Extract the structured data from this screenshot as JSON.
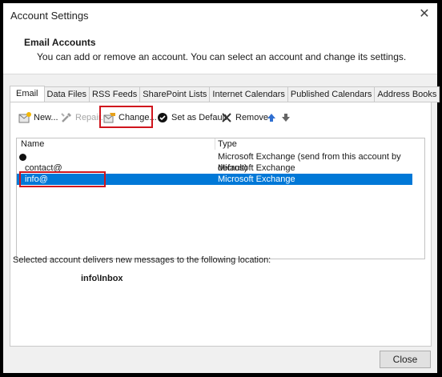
{
  "window": {
    "title": "Account Settings"
  },
  "header": {
    "title": "Email Accounts",
    "description": "You can add or remove an account. You can select an account and change its settings."
  },
  "tabs": [
    {
      "label": "Email",
      "active": true
    },
    {
      "label": "Data Files"
    },
    {
      "label": "RSS Feeds"
    },
    {
      "label": "SharePoint Lists"
    },
    {
      "label": "Internet Calendars"
    },
    {
      "label": "Published Calendars"
    },
    {
      "label": "Address Books"
    }
  ],
  "toolbar": {
    "new": "New...",
    "repair": "Repair...",
    "change": "Change...",
    "set_default": "Set as Default",
    "remove": "Remove"
  },
  "list": {
    "columns": [
      "Name",
      "Type"
    ],
    "rows": [
      {
        "name": "",
        "type": "Microsoft Exchange (send from this account by default)",
        "default": true
      },
      {
        "name": "contact@",
        "type": "Microsoft Exchange"
      },
      {
        "name": "info@",
        "type": "Microsoft Exchange",
        "selected": true
      }
    ]
  },
  "delivery": {
    "text": "Selected account delivers new messages to the following location:",
    "location": "info\\Inbox"
  },
  "footer": {
    "close": "Close"
  },
  "colors": {
    "selection": "#0078d7",
    "highlight_box": "#d0151d"
  }
}
